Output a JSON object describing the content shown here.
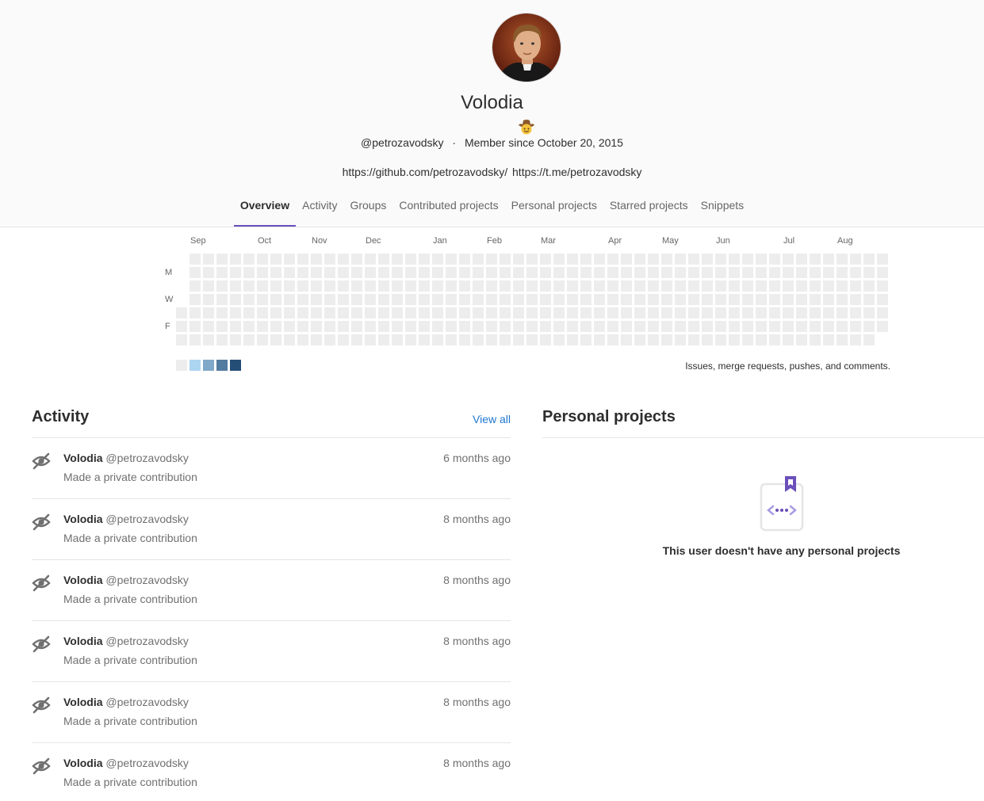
{
  "profile": {
    "name": "Volodia",
    "username": "@petrozavodsky",
    "separator": "·",
    "member_since": "Member since October 20, 2015",
    "links": [
      "https://github.com/petrozavodsky/",
      "https://t.me/petrozavodsky"
    ],
    "status_icon": "cowboy-emoji"
  },
  "tabs": [
    {
      "label": "Overview",
      "active": true
    },
    {
      "label": "Activity",
      "active": false
    },
    {
      "label": "Groups",
      "active": false
    },
    {
      "label": "Contributed projects",
      "active": false
    },
    {
      "label": "Personal projects",
      "active": false
    },
    {
      "label": "Starred projects",
      "active": false
    },
    {
      "label": "Snippets",
      "active": false
    }
  ],
  "calendar": {
    "months": [
      "Sep",
      "Oct",
      "Nov",
      "Dec",
      "Jan",
      "Feb",
      "Mar",
      "Apr",
      "May",
      "Jun",
      "Jul",
      "Aug"
    ],
    "days": [
      "M",
      "W",
      "F"
    ],
    "legend_colors": [
      "#ededed",
      "#acd5f2",
      "#7fa8c9",
      "#527ba0",
      "#254e77"
    ],
    "legend_text": "Issues, merge requests, pushes, and comments."
  },
  "activity": {
    "title": "Activity",
    "view_all": "View all",
    "events": [
      {
        "author": "Volodia",
        "username": "@petrozavodsky",
        "text": "Made a private contribution",
        "time": "6 months ago",
        "icon": "eye-slash-icon"
      },
      {
        "author": "Volodia",
        "username": "@petrozavodsky",
        "text": "Made a private contribution",
        "time": "8 months ago",
        "icon": "eye-slash-icon"
      },
      {
        "author": "Volodia",
        "username": "@petrozavodsky",
        "text": "Made a private contribution",
        "time": "8 months ago",
        "icon": "eye-slash-icon"
      },
      {
        "author": "Volodia",
        "username": "@petrozavodsky",
        "text": "Made a private contribution",
        "time": "8 months ago",
        "icon": "eye-slash-icon"
      },
      {
        "author": "Volodia",
        "username": "@petrozavodsky",
        "text": "Made a private contribution",
        "time": "8 months ago",
        "icon": "eye-slash-icon"
      },
      {
        "author": "Volodia",
        "username": "@petrozavodsky",
        "text": "Made a private contribution",
        "time": "8 months ago",
        "icon": "eye-slash-icon"
      }
    ]
  },
  "personal_projects": {
    "title": "Personal projects",
    "empty_text": "This user doesn't have any personal projects"
  },
  "colors": {
    "accent": "#6b4fbb",
    "link": "#1f78d1"
  }
}
